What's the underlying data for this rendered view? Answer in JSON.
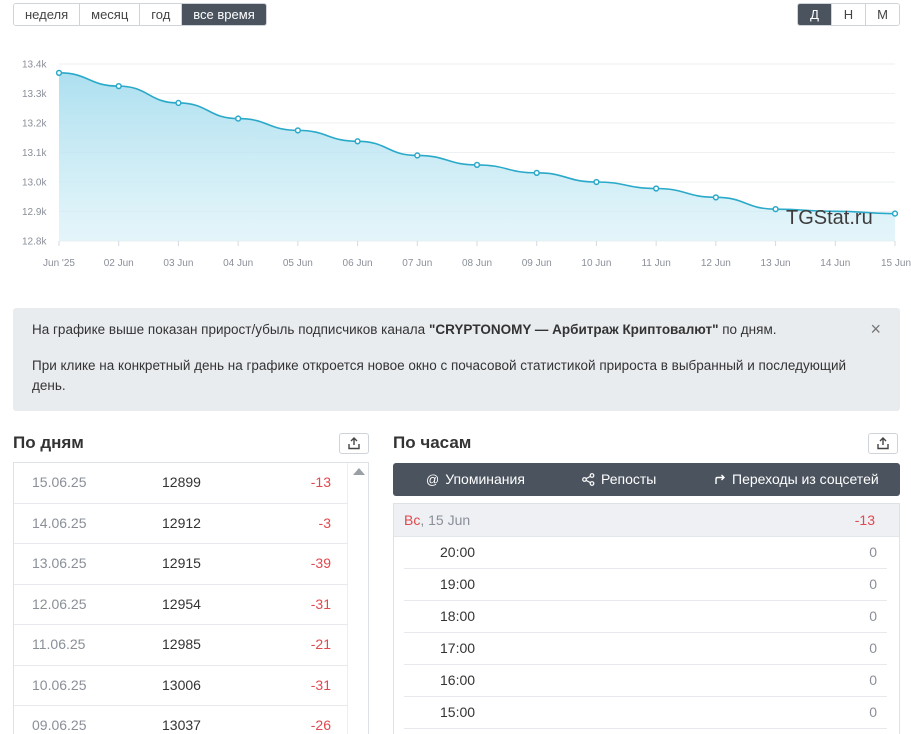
{
  "period_tabs": [
    {
      "label": "неделя",
      "active": false
    },
    {
      "label": "месяц",
      "active": false
    },
    {
      "label": "год",
      "active": false
    },
    {
      "label": "все время",
      "active": true
    }
  ],
  "granularity_tabs": [
    {
      "label": "Д",
      "active": true
    },
    {
      "label": "Н",
      "active": false
    },
    {
      "label": "М",
      "active": false
    }
  ],
  "chart_data": {
    "type": "area",
    "x": [
      "Jun '25",
      "02 Jun",
      "03 Jun",
      "04 Jun",
      "05 Jun",
      "06 Jun",
      "07 Jun",
      "08 Jun",
      "09 Jun",
      "10 Jun",
      "11 Jun",
      "12 Jun",
      "13 Jun",
      "14 Jun",
      "15 Jun"
    ],
    "series": [
      {
        "values": [
          13370,
          13325,
          13268,
          13215,
          13175,
          13138,
          13090,
          13058,
          13031,
          13000,
          12978,
          12948,
          12908,
          null,
          12893
        ]
      }
    ],
    "y_ticks": [
      "12.8k",
      "12.9k",
      "13.0k",
      "13.1k",
      "13.2k",
      "13.3k",
      "13.4k"
    ],
    "ylim": [
      12800,
      13400
    ],
    "grid": true,
    "watermark": "TGStat.ru",
    "line_color": "#2aa9c9",
    "fill_color": "#bfe7f2"
  },
  "info": {
    "line1_pre": "На графике выше показан прирост/убыль подписчиков канала ",
    "channel": "\"CRYPTONOMY — Арбитраж Криптовалют\"",
    "line1_post": " по дням.",
    "line2": "При клике на конкретный день на графике откроется новое окно с почасовой статистикой прироста в выбранный и последующий день.",
    "close": "×"
  },
  "by_days": {
    "title": "По дням",
    "rows": [
      {
        "date": "15.06.25",
        "value": "12899",
        "change": "-13"
      },
      {
        "date": "14.06.25",
        "value": "12912",
        "change": "-3"
      },
      {
        "date": "13.06.25",
        "value": "12915",
        "change": "-39"
      },
      {
        "date": "12.06.25",
        "value": "12954",
        "change": "-31"
      },
      {
        "date": "11.06.25",
        "value": "12985",
        "change": "-21"
      },
      {
        "date": "10.06.25",
        "value": "13006",
        "change": "-31"
      },
      {
        "date": "09.06.25",
        "value": "13037",
        "change": "-26"
      }
    ]
  },
  "by_hours": {
    "title": "По часам",
    "tabs": [
      "Упоминания",
      "Репосты",
      "Переходы из соцсетей"
    ],
    "day_weekday": "Вс",
    "day_date": ", 15 Jun",
    "day_total": "-13",
    "rows": [
      {
        "hour": "20:00",
        "count": "0"
      },
      {
        "hour": "19:00",
        "count": "0"
      },
      {
        "hour": "18:00",
        "count": "0"
      },
      {
        "hour": "17:00",
        "count": "0"
      },
      {
        "hour": "16:00",
        "count": "0"
      },
      {
        "hour": "15:00",
        "count": "0"
      }
    ]
  }
}
